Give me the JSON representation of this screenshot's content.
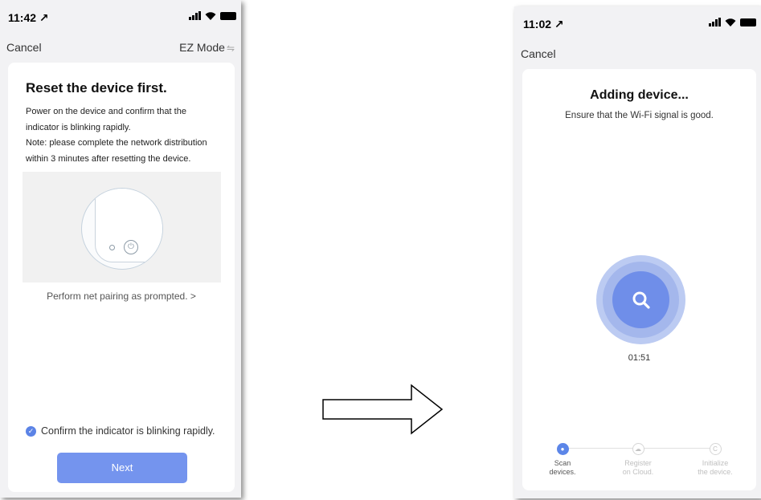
{
  "left_screen": {
    "status": {
      "time": "11:42 ↗"
    },
    "nav": {
      "cancel": "Cancel",
      "mode": "EZ Mode",
      "mode_icon": "⇋"
    },
    "title": "Reset the device first.",
    "instructions": "Power on the device and confirm that the indicator is blinking rapidly.\nNote: please complete the network distribution within 3 minutes after resetting the device.",
    "pairing_link": "Perform net pairing as prompted. >",
    "confirm_label": "Confirm the indicator is blinking rapidly.",
    "confirm_checked": true,
    "next_button": "Next"
  },
  "right_screen": {
    "status": {
      "time": "11:02 ↗"
    },
    "nav": {
      "cancel": "Cancel"
    },
    "title": "Adding device...",
    "subtitle": "Ensure that the Wi-Fi signal is good.",
    "timer": "01:51",
    "steps": [
      {
        "label": "Scan\ndevices.",
        "active": true
      },
      {
        "label": "Register\non Cloud.",
        "active": false
      },
      {
        "label": "Initialize\nthe device.",
        "active": false
      }
    ]
  },
  "colors": {
    "accent": "#5c86e8",
    "button": "#7494ee",
    "scan_outer": "#bccbf2",
    "scan_inner": "#6f8ee9",
    "background": "#f2f2f4"
  },
  "icons": {
    "check": "checkmark-icon",
    "power": "power-icon",
    "search": "search-icon",
    "flow": "right-arrow-icon"
  }
}
